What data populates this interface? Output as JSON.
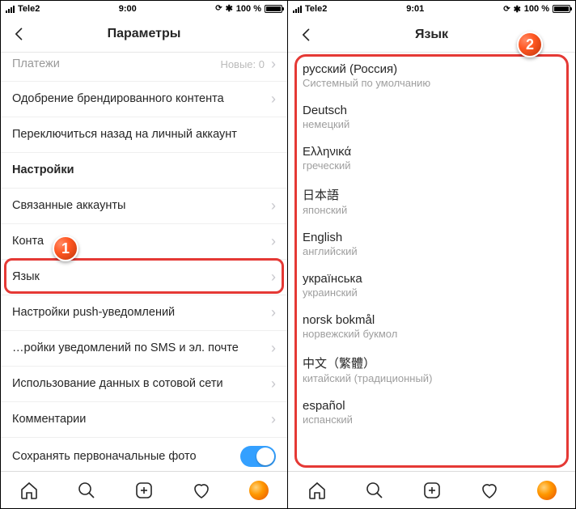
{
  "left": {
    "status": {
      "carrier": "Tele2",
      "time": "9:00",
      "battery": "100 %"
    },
    "nav": {
      "title": "Параметры"
    },
    "rows": {
      "paymentsLabel": "Платежи",
      "paymentsMeta": "Новые: 0",
      "brandedLabel": "Одобрение брендированного контента",
      "switchBackLabel": "Переключиться назад на личный аккаунт",
      "sectionLabel": "Настройки",
      "linkedLabel": "Связанные аккаунты",
      "contactsLabel": "Конта",
      "languageLabel": "Язык",
      "pushLabel": "Настройки push-уведомлений",
      "smsEmailLabel": "…ройки уведомлений по SMS и эл. почте",
      "cellularLabel": "Использование данных в сотовой сети",
      "commentsLabel": "Комментарии",
      "saveOriginalLabel": "Сохранять первоначальные фото"
    }
  },
  "right": {
    "status": {
      "carrier": "Tele2",
      "time": "9:01",
      "battery": "100 %"
    },
    "nav": {
      "title": "Язык"
    },
    "languages": [
      {
        "name": "русский (Россия)",
        "sub": "Системный по умолчанию"
      },
      {
        "name": "Deutsch",
        "sub": "немецкий"
      },
      {
        "name": "Ελληνικά",
        "sub": "греческий"
      },
      {
        "name": "日本語",
        "sub": "японский"
      },
      {
        "name": "English",
        "sub": "английский"
      },
      {
        "name": "українська",
        "sub": "украинский"
      },
      {
        "name": "norsk bokmål",
        "sub": "норвежский букмол"
      },
      {
        "name": "中文（繁體）",
        "sub": "китайский (традиционный)"
      },
      {
        "name": "español",
        "sub": "испанский"
      }
    ]
  },
  "badges": {
    "one": "1",
    "two": "2"
  }
}
